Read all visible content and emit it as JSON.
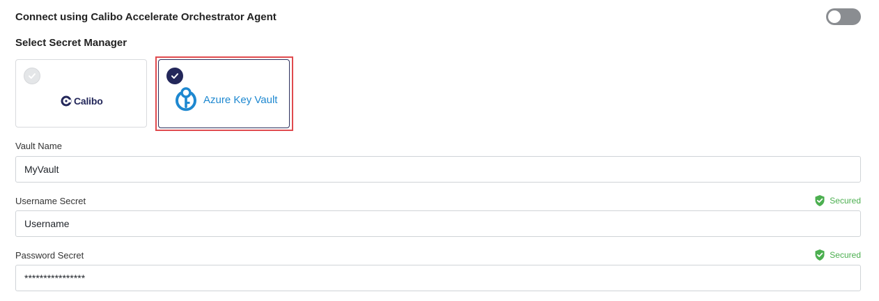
{
  "agent": {
    "label": "Connect using Calibo Accelerate Orchestrator Agent",
    "enabled": false
  },
  "secret_manager": {
    "title": "Select Secret Manager",
    "options": [
      {
        "name": "Calibo",
        "selected": false
      },
      {
        "name": "Azure Key Vault",
        "selected": true
      }
    ]
  },
  "fields": {
    "vault_name": {
      "label": "Vault Name",
      "value": "MyVault"
    },
    "username_secret": {
      "label": "Username Secret",
      "value": "Username",
      "badge": "Secured"
    },
    "password_secret": {
      "label": "Password Secret",
      "value": "****************",
      "badge": "Secured"
    }
  },
  "colors": {
    "brand_navy": "#23275a",
    "azure_blue": "#1e88d0",
    "selected_outline": "#e04a4e",
    "secured_green": "#4caf50",
    "toggle_off": "#8a8d91"
  },
  "icons": {
    "check": "check-circle-icon",
    "calibo": "calibo-logo-icon",
    "azure": "azure-key-vault-icon",
    "secured": "shield-check-icon"
  }
}
